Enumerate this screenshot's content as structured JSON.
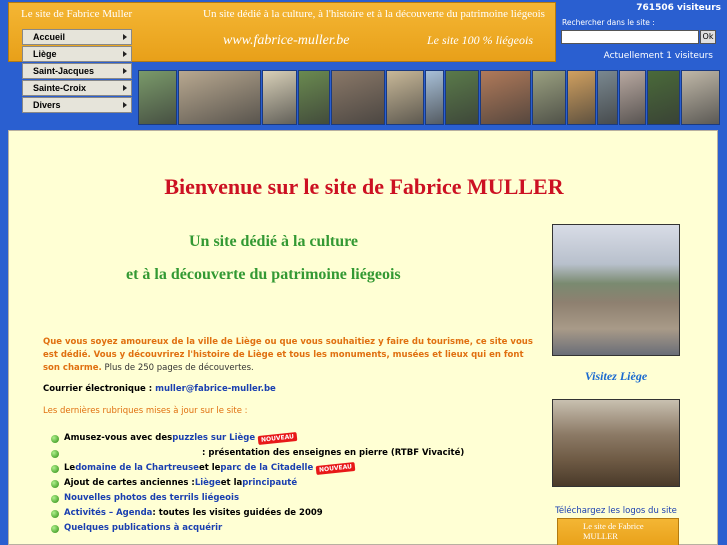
{
  "banner": {
    "site_name": "Le site de Fabrice Muller",
    "tagline": "Un site dédié à la culture, à l'histoire et à la découverte du patrimoine liégeois",
    "url": "www.fabrice-muller.be",
    "slogan": "Le site 100 % liégeois"
  },
  "nav": {
    "items": [
      {
        "label": "Accueil"
      },
      {
        "label": "Liège"
      },
      {
        "label": "Saint-Jacques"
      },
      {
        "label": "Sainte-Croix"
      },
      {
        "label": "Divers"
      }
    ]
  },
  "header_right": {
    "visits_total": "761506 visiteurs",
    "search_label": "Rechercher dans le site :",
    "search_button": "Ok",
    "visits_now": "Actuellement 1 visiteurs"
  },
  "photo_strip": {
    "colors": [
      "#7a9a6a",
      "#b8a890",
      "#d8d0b8",
      "#6a8a50",
      "#8a7868",
      "#c8b898",
      "#a8c0d8",
      "#5a7a4a",
      "#b07a5a",
      "#9aa080",
      "#d0a060",
      "#7a8890",
      "#b8a8a0",
      "#4a6a3a",
      "#c0b8a8"
    ]
  },
  "main": {
    "welcome": "Bienvenue sur le site de Fabrice MULLER",
    "sub1": "Un site dédié à la culture",
    "sub2": "et à la découverte du patrimoine liégeois",
    "intro_orange": "Que vous soyez amoureux de la ville de Liège ou que vous souhaitiez y faire du tourisme, ce site vous est dédié. Vous y découvrirez l'histoire de Liège et tous les monuments, musées et lieux qui en font son charme.",
    "intro_rest": " Plus de 250 pages de découvertes.",
    "email_label": "Courrier électronique : ",
    "email": "muller@fabrice-muller.be",
    "latest_label": "Les dernières rubriques mises à jour sur le site :",
    "new_badge": "NOUVEAU",
    "updates": {
      "u1_text": "Amusez-vous avec des ",
      "u1_link": "puzzles sur Liège",
      "u2_text": ": présentation des enseignes en pierre (RTBF Vivacité)",
      "u3_text1": "Le ",
      "u3_link1": "domaine de la Chartreuse",
      "u3_text2": " et le ",
      "u3_link2": "parc de la Citadelle",
      "u4_text1": "Ajout de cartes anciennes : ",
      "u4_link1": "Liège",
      "u4_text2": " et la ",
      "u4_link2": "principauté",
      "u5_link": "Nouvelles photos des terrils liégeois",
      "u6_link": "Activités – Agenda",
      "u6_text": " : toutes les visites guidées de 2009",
      "u7_link": "Quelques publications à acquérir"
    }
  },
  "right_col": {
    "visitez": "Visitez Liège",
    "logos_link": "Téléchargez les logos du site",
    "mini_banner": "Le site de Fabrice MULLER"
  }
}
